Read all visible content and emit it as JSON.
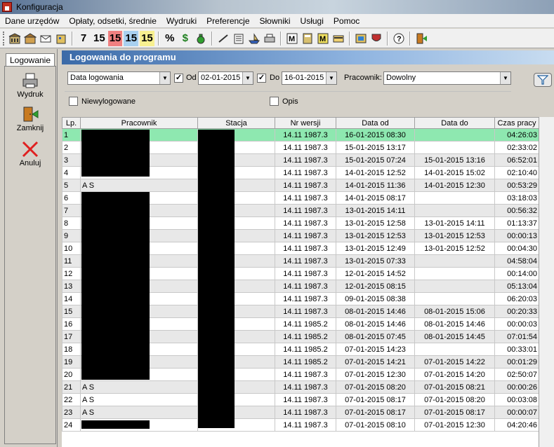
{
  "window": {
    "title": "Konfiguracja"
  },
  "menu": [
    "Dane urzędów",
    "Opłaty, odsetki, średnie",
    "Wydruki",
    "Preferencje",
    "Słowniki",
    "Usługi",
    "Pomoc"
  ],
  "toolbar": {
    "num7": "7",
    "num15a": "15",
    "num15b": "15",
    "num15c": "15",
    "num15d": "15",
    "percent": "%",
    "dollar": "$",
    "colors": {
      "red_bg": "#f08080",
      "blue_bg": "#a8d0f0",
      "yellow_bg": "#f8f090"
    }
  },
  "sidebar": {
    "tab_label": "Logowanie",
    "buttons": [
      {
        "label": "Wydruk",
        "icon": "printer-icon"
      },
      {
        "label": "Zamknij",
        "icon": "exit-door-icon"
      },
      {
        "label": "Anuluj",
        "icon": "cancel-x-icon"
      }
    ]
  },
  "header": {
    "title": "Logowania do programu"
  },
  "filters": {
    "date_type": "Data logowania",
    "od_label": "Od",
    "od_value": "02-01-2015",
    "od_checked": true,
    "do_label": "Do",
    "do_value": "16-01-2015",
    "do_checked": true,
    "worker_label": "Pracownik:",
    "worker_value": "Dowolny",
    "niewylogowane_label": "Niewylogowane",
    "niewylogowane_checked": false,
    "opis_label": "Opis",
    "opis_checked": false
  },
  "table": {
    "columns": [
      "Lp.",
      "Pracownik",
      "Stacja",
      "Nr wersji",
      "Data od",
      "Data do",
      "Czas pracy"
    ],
    "rows": [
      {
        "lp": "1",
        "pracownik": "",
        "stacja": "",
        "wersja": "14.11 1987.3",
        "od": "16-01-2015 08:30",
        "do": "",
        "czas": "04:26:03"
      },
      {
        "lp": "2",
        "pracownik": "",
        "stacja": "",
        "wersja": "14.11 1987.3",
        "od": "15-01-2015 13:17",
        "do": "",
        "czas": "02:33:02"
      },
      {
        "lp": "3",
        "pracownik": "",
        "stacja": "",
        "wersja": "14.11 1987.3",
        "od": "15-01-2015 07:24",
        "do": "15-01-2015 13:16",
        "czas": "06:52:01"
      },
      {
        "lp": "4",
        "pracownik": "",
        "stacja": "",
        "wersja": "14.11 1987.3",
        "od": "14-01-2015 12:52",
        "do": "14-01-2015 15:02",
        "czas": "02:10:40"
      },
      {
        "lp": "5",
        "pracownik": "A S",
        "stacja": "",
        "wersja": "14.11 1987.3",
        "od": "14-01-2015 11:36",
        "do": "14-01-2015 12:30",
        "czas": "00:53:29"
      },
      {
        "lp": "6",
        "pracownik": "",
        "stacja": "",
        "wersja": "14.11 1987.3",
        "od": "14-01-2015 08:17",
        "do": "",
        "czas": "03:18:03"
      },
      {
        "lp": "7",
        "pracownik": "",
        "stacja": "",
        "wersja": "14.11 1987.3",
        "od": "13-01-2015 14:11",
        "do": "",
        "czas": "00:56:32"
      },
      {
        "lp": "8",
        "pracownik": "",
        "stacja": "",
        "wersja": "14.11 1987.3",
        "od": "13-01-2015 12:58",
        "do": "13-01-2015 14:11",
        "czas": "01:13:37"
      },
      {
        "lp": "9",
        "pracownik": "",
        "stacja": "",
        "wersja": "14.11 1987.3",
        "od": "13-01-2015 12:53",
        "do": "13-01-2015 12:53",
        "czas": "00:00:13"
      },
      {
        "lp": "10",
        "pracownik": "",
        "stacja": "",
        "wersja": "14.11 1987.3",
        "od": "13-01-2015 12:49",
        "do": "13-01-2015 12:52",
        "czas": "00:04:30"
      },
      {
        "lp": "11",
        "pracownik": "",
        "stacja": "",
        "wersja": "14.11 1987.3",
        "od": "13-01-2015 07:33",
        "do": "",
        "czas": "04:58:04"
      },
      {
        "lp": "12",
        "pracownik": "",
        "stacja": "",
        "wersja": "14.11 1987.3",
        "od": "12-01-2015 14:52",
        "do": "",
        "czas": "00:14:00"
      },
      {
        "lp": "13",
        "pracownik": "",
        "stacja": "",
        "wersja": "14.11 1987.3",
        "od": "12-01-2015 08:15",
        "do": "",
        "czas": "05:13:04"
      },
      {
        "lp": "14",
        "pracownik": "",
        "stacja": "",
        "wersja": "14.11 1987.3",
        "od": "09-01-2015 08:38",
        "do": "",
        "czas": "06:20:03"
      },
      {
        "lp": "15",
        "pracownik": "",
        "stacja": "",
        "wersja": "14.11 1987.3",
        "od": "08-01-2015 14:46",
        "do": "08-01-2015 15:06",
        "czas": "00:20:33"
      },
      {
        "lp": "16",
        "pracownik": "",
        "stacja": "",
        "wersja": "14.11 1985.2",
        "od": "08-01-2015 14:46",
        "do": "08-01-2015 14:46",
        "czas": "00:00:03"
      },
      {
        "lp": "17",
        "pracownik": "",
        "stacja": "",
        "wersja": "14.11 1985.2",
        "od": "08-01-2015 07:45",
        "do": "08-01-2015 14:45",
        "czas": "07:01:54"
      },
      {
        "lp": "18",
        "pracownik": "",
        "stacja": "",
        "wersja": "14.11 1985.2",
        "od": "07-01-2015 14:23",
        "do": "",
        "czas": "00:33:01"
      },
      {
        "lp": "19",
        "pracownik": "",
        "stacja": "",
        "wersja": "14.11 1985.2",
        "od": "07-01-2015 14:21",
        "do": "07-01-2015 14:22",
        "czas": "00:01:29"
      },
      {
        "lp": "20",
        "pracownik": "",
        "stacja": "",
        "wersja": "14.11 1987.3",
        "od": "07-01-2015 12:30",
        "do": "07-01-2015 14:20",
        "czas": "02:50:07"
      },
      {
        "lp": "21",
        "pracownik": "A S",
        "stacja": "",
        "wersja": "14.11 1987.3",
        "od": "07-01-2015 08:20",
        "do": "07-01-2015 08:21",
        "czas": "00:00:26"
      },
      {
        "lp": "22",
        "pracownik": "A S",
        "stacja": "",
        "wersja": "14.11 1987.3",
        "od": "07-01-2015 08:17",
        "do": "07-01-2015 08:20",
        "czas": "00:03:08"
      },
      {
        "lp": "23",
        "pracownik": "A S",
        "stacja": "",
        "wersja": "14.11 1987.3",
        "od": "07-01-2015 08:17",
        "do": "07-01-2015 08:17",
        "czas": "00:00:07"
      },
      {
        "lp": "24",
        "pracownik": "",
        "stacja": "",
        "wersja": "14.11 1987.3",
        "od": "07-01-2015 08:10",
        "do": "07-01-2015 12:30",
        "czas": "04:20:46"
      }
    ],
    "selected_row": 0
  }
}
